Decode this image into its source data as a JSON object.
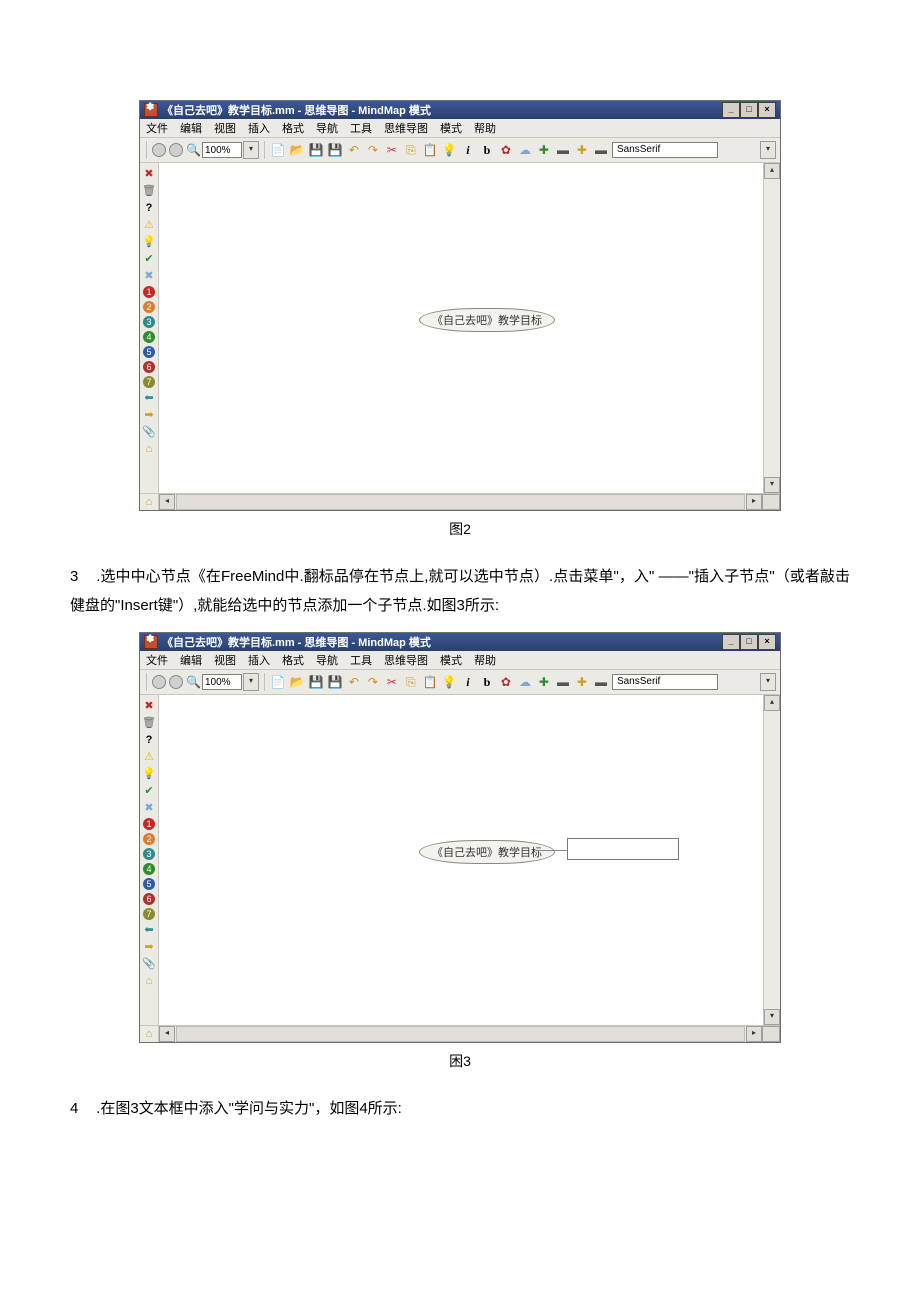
{
  "window": {
    "title": "《自己去吧》教学目标.mm - 思维导图 - MindMap 模式",
    "font_name": "SansSerif",
    "zoom": "100%"
  },
  "menu": {
    "file": "文件",
    "edit": "编辑",
    "view": "视图",
    "insert": "插入",
    "format": "格式",
    "navigate": "导航",
    "tools": "工具",
    "mindmap": "思维导图",
    "mode": "模式",
    "help": "帮助"
  },
  "node": {
    "root": "《自己去吧》教学目标"
  },
  "captions": {
    "fig2": "图2",
    "fig3": "困3"
  },
  "steps": {
    "s3_num": "3",
    "s3_text": ".选中中心节点《在FreeMind中.翻标品停在节点上,就可以选中节点）.点击菜单\"，入\" ——\"插入子节点\"（或者敲击健盘的\"Insert键\"）,就能给选中的节点添加一个子节点.如图3所示:",
    "s4_num": "4",
    "s4_text": ".在图3文本框中添入\"学问与实力\"，如图4所示:"
  }
}
